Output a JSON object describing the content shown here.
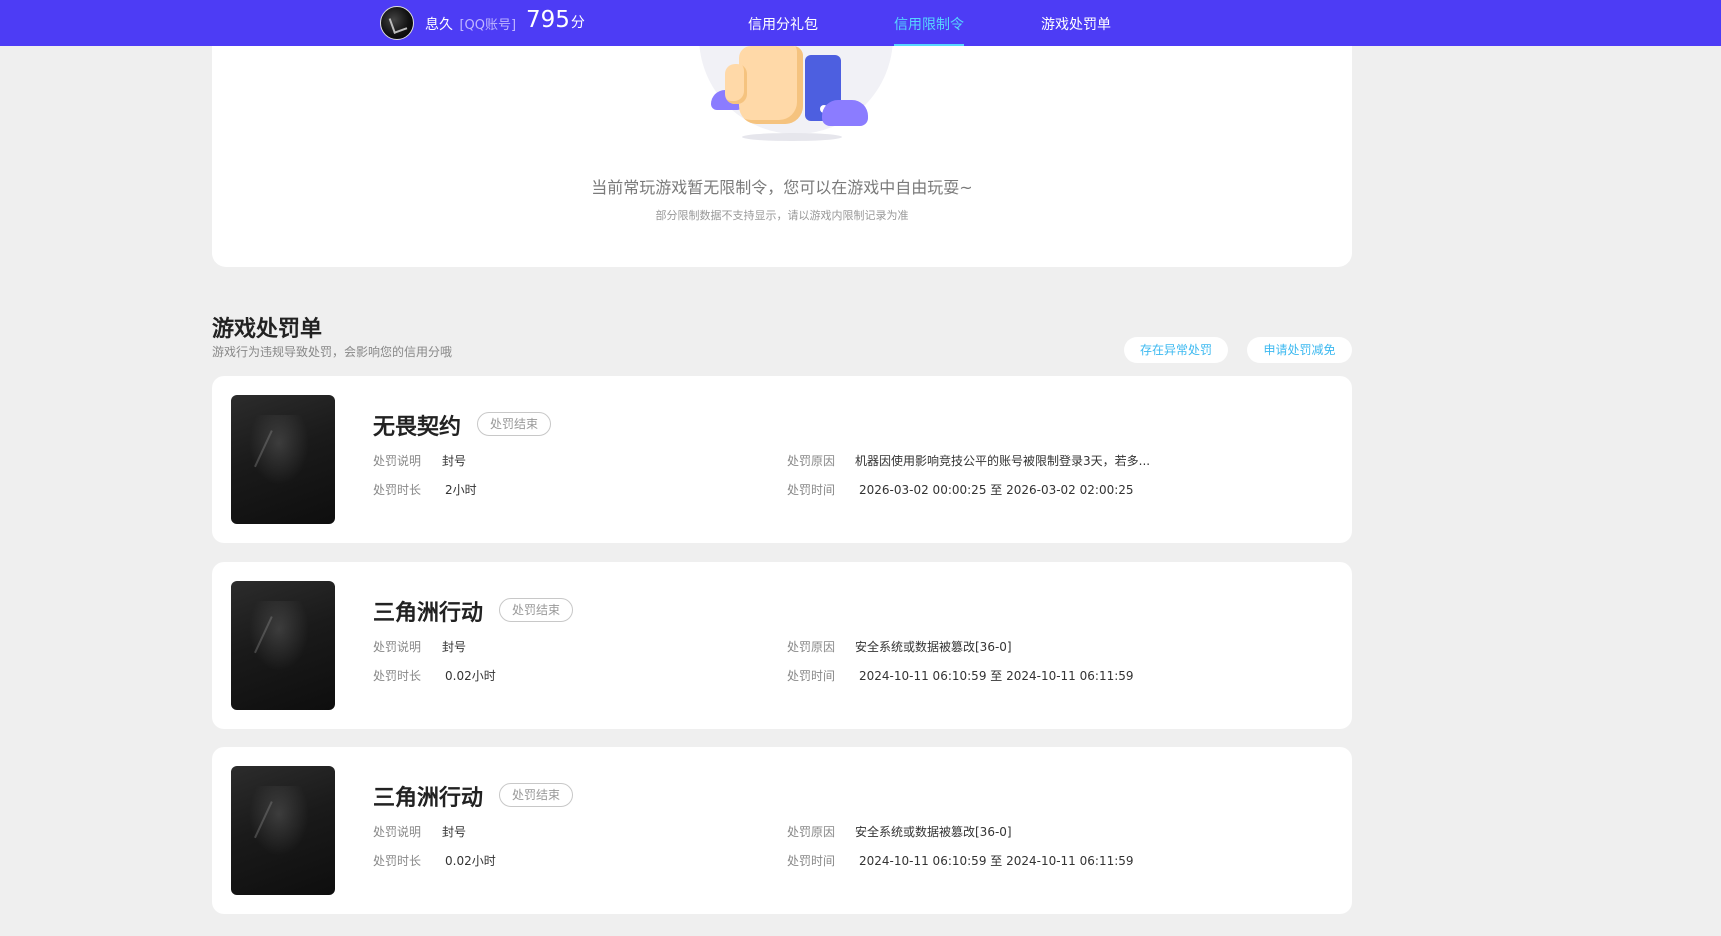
{
  "header": {
    "username": "息久",
    "account_type": "[QQ账号]",
    "score": "795",
    "score_unit": "分",
    "tabs": [
      {
        "label": "信用分礼包",
        "active": false
      },
      {
        "label": "信用限制令",
        "active": true
      },
      {
        "label": "游戏处罚单",
        "active": false
      }
    ]
  },
  "restriction": {
    "empty_message": "当前常玩游戏暂无限制令，您可以在游戏中自由玩耍~",
    "note": "部分限制数据不支持显示，请以游戏内限制记录为准"
  },
  "penalty_section": {
    "title": "游戏处罚单",
    "subtitle": "游戏行为违规导致处罚，会影响您的信用分哦",
    "buttons": {
      "abnormal": "存在异常处罚",
      "appeal": "申请处罚减免"
    }
  },
  "labels": {
    "desc": "处罚说明",
    "duration": "处罚时长",
    "reason": "处罚原因",
    "time": "处罚时间"
  },
  "penalties": [
    {
      "game": "无畏契约",
      "status": "处罚结束",
      "desc": "封号",
      "duration": "2小时",
      "reason": "机器因使用影响竞技公平的账号被限制登录3天，若多...",
      "time": "2026-03-02 00:00:25 至 2026-03-02 02:00:25"
    },
    {
      "game": "三角洲行动",
      "status": "处罚结束",
      "desc": "封号",
      "duration": "0.02小时",
      "reason": "安全系统或数据被篡改[36-0]",
      "time": "2024-10-11 06:10:59 至 2024-10-11 06:11:59"
    },
    {
      "game": "三角洲行动",
      "status": "处罚结束",
      "desc": "封号",
      "duration": "0.02小时",
      "reason": "安全系统或数据被篡改[36-0]",
      "time": "2024-10-11 06:10:59 至 2024-10-11 06:11:59"
    }
  ],
  "colors": {
    "nav_bg": "#4d3cf5",
    "nav_active": "#57d6ff",
    "link": "#3db9f0",
    "page_bg": "#efefef"
  }
}
